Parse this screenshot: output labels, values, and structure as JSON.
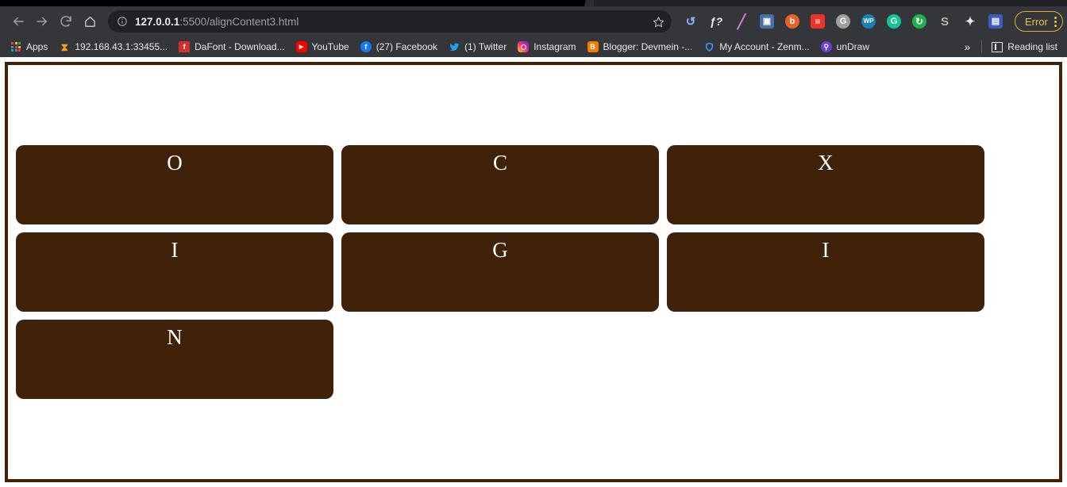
{
  "browser": {
    "nav": {
      "back": "back-arrow",
      "forward": "forward-arrow",
      "reload": "reload",
      "home": "home"
    },
    "omnibox": {
      "info_icon": "site-information",
      "host": "127.0.0.1",
      "path": ":5500/alignContent3.html",
      "full_url": "127.0.0.1:5500/alignContent3.html",
      "bookmark_star": "star"
    },
    "extensions": [
      {
        "name": "history-rewind-extension",
        "glyph": "↺",
        "bg": "transparent",
        "fg": "#8ab4f8"
      },
      {
        "name": "math-function-extension",
        "glyph": "ƒ?",
        "bg": "transparent",
        "fg": "#e8eaed"
      },
      {
        "name": "marker-pen-extension",
        "glyph": "╱",
        "bg": "transparent",
        "fg": "#c77fd6"
      },
      {
        "name": "screenshot-extension",
        "glyph": "▣",
        "bg": "#4a6fa5",
        "fg": "#ffffff"
      },
      {
        "name": "bitwarden-extension",
        "glyph": "b",
        "bg": "#e8622a",
        "fg": "#ffffff"
      },
      {
        "name": "stylus-extension",
        "glyph": "≡",
        "bg": "#e8342a",
        "fg": "#ffffff"
      },
      {
        "name": "grey-circle-extension",
        "glyph": "G",
        "bg": "#9e9e9e",
        "fg": "#ffffff"
      },
      {
        "name": "wordpress-extension",
        "glyph": "WP",
        "bg": "#1a7fb5",
        "fg": "#ffffff"
      },
      {
        "name": "grammarly-extension",
        "glyph": "G",
        "bg": "#15c39a",
        "fg": "#ffffff"
      },
      {
        "name": "sync-extension",
        "glyph": "↻",
        "bg": "#20b24a",
        "fg": "#ffffff"
      },
      {
        "name": "sass-extension",
        "glyph": "S",
        "bg": "transparent",
        "fg": "#b7b7b7"
      },
      {
        "name": "puzzle-extensions-menu",
        "glyph": "✦",
        "bg": "transparent",
        "fg": "#e8eaed"
      },
      {
        "name": "devtools-extension",
        "glyph": "▤",
        "bg": "#3b5bbf",
        "fg": "#ffffff"
      }
    ],
    "error_button": {
      "label": "Error",
      "menu_icon": "three-dot-menu",
      "accent": "#e3c44d"
    },
    "bookmarks": [
      {
        "name": "apps",
        "label": "Apps",
        "icon": "apps-grid",
        "fav_bg": "transparent",
        "fav_fg": "#ffffff",
        "glyph": ""
      },
      {
        "name": "local-server",
        "label": "192.168.43.1:33455...",
        "icon": "xampp-icon",
        "fav_bg": "transparent",
        "fav_fg": "#f6a01a",
        "glyph": "⧗"
      },
      {
        "name": "dafont",
        "label": "DaFont - Download...",
        "icon": "dafont-icon",
        "fav_bg": "#d32f2f",
        "fav_fg": "#ffffff",
        "glyph": "f"
      },
      {
        "name": "youtube",
        "label": "YouTube",
        "icon": "youtube-icon",
        "fav_bg": "#ff0000",
        "fav_fg": "#ffffff",
        "glyph": "▶"
      },
      {
        "name": "facebook",
        "label": "(27) Facebook",
        "icon": "facebook-icon",
        "fav_bg": "#1877f2",
        "fav_fg": "#ffffff",
        "glyph": "f"
      },
      {
        "name": "twitter",
        "label": "(1) Twitter",
        "icon": "twitter-icon",
        "fav_bg": "transparent",
        "fav_fg": "#1da1f2",
        "glyph": "✉"
      },
      {
        "name": "instagram",
        "label": "Instagram",
        "icon": "instagram-icon",
        "fav_bg": "#e1306c",
        "fav_fg": "#ffffff",
        "glyph": "□"
      },
      {
        "name": "blogger",
        "label": "Blogger: Devmein -...",
        "icon": "blogger-icon",
        "fav_bg": "#f57c00",
        "fav_fg": "#ffffff",
        "glyph": "B"
      },
      {
        "name": "zenmate",
        "label": "My Account - Zenm...",
        "icon": "shield-icon",
        "fav_bg": "transparent",
        "fav_fg": "#3d8df5",
        "glyph": "⛨"
      },
      {
        "name": "undraw",
        "label": "unDraw",
        "icon": "undraw-icon",
        "fav_bg": "#6c3fd1",
        "fav_fg": "#ffffff",
        "glyph": "⚲"
      }
    ],
    "overflow_chevron": "»",
    "reading_list": {
      "label": "Reading list",
      "icon": "reading-list-icon"
    }
  },
  "page": {
    "container": {
      "name": "flex-container",
      "border_color": "#40210a",
      "cell_color": "#3f2209",
      "text_color": "#ffffff"
    },
    "cells": [
      {
        "letter": "O"
      },
      {
        "letter": "C"
      },
      {
        "letter": "X"
      },
      {
        "letter": "I"
      },
      {
        "letter": "G"
      },
      {
        "letter": "I"
      },
      {
        "letter": "N"
      }
    ]
  }
}
